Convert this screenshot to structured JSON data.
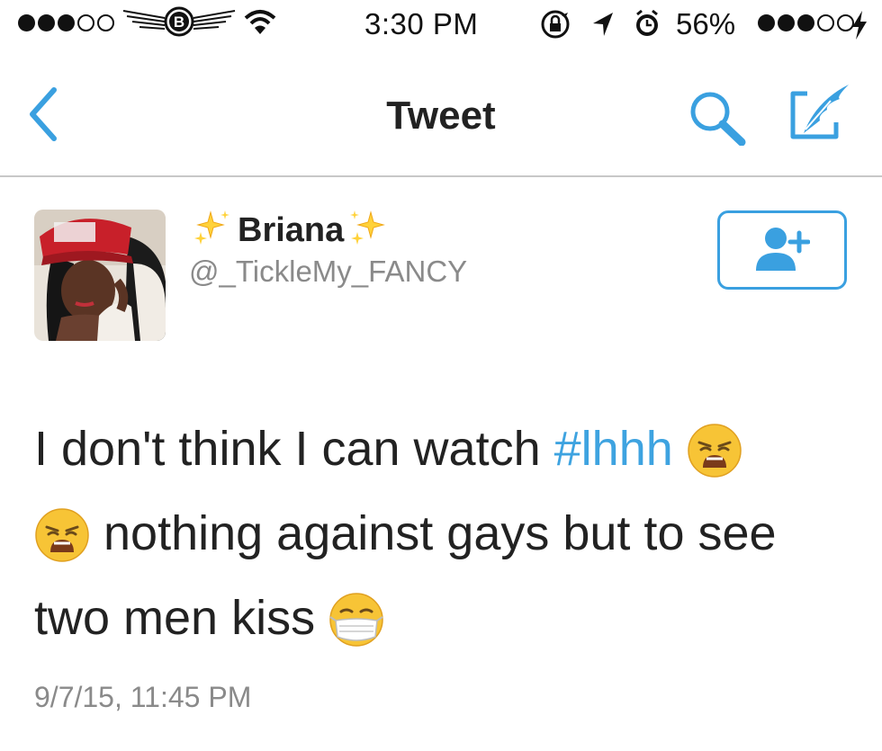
{
  "status_bar": {
    "time": "3:30 PM",
    "battery": "56%",
    "signal_left": [
      true,
      true,
      true,
      false,
      false
    ],
    "signal_right": [
      true,
      true,
      true,
      false,
      false
    ],
    "icons": [
      "signal-dots-icon",
      "carrier-logo-icon",
      "wifi-icon",
      "rotation-lock-icon",
      "location-arrow-icon",
      "alarm-icon",
      "charging-bolt-icon"
    ]
  },
  "nav": {
    "title": "Tweet",
    "accent": "#3aa0e0",
    "icons": [
      "back-chevron-icon",
      "search-icon",
      "compose-icon"
    ]
  },
  "tweet": {
    "author": {
      "name": "Briana",
      "handle": "@_TickleMy_FANCY",
      "name_decor": [
        "sparkles-emoji",
        "sparkles-emoji"
      ]
    },
    "follow_icon": "follow-person-plus-icon",
    "text": {
      "part1": "I don't think I can watch ",
      "hashtag": "#lhhh",
      "part2": " nothing against gays but to see two men kiss",
      "emojis": [
        "weary-face-emoji",
        "weary-face-emoji",
        "medical-mask-emoji"
      ]
    },
    "timestamp": "9/7/15, 11:45 PM",
    "hashtag_color": "#3ea3e0"
  }
}
